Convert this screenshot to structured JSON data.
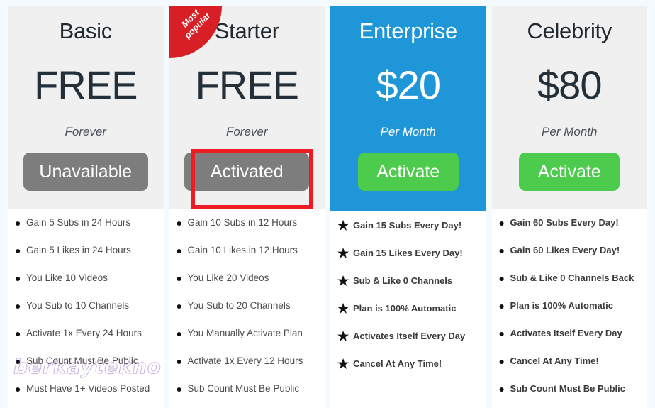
{
  "page": {
    "background_color": "#f4fafd",
    "watermark_text": "berkaytekno"
  },
  "colors": {
    "header_bg": "#f0f0f0",
    "featured_bg": "#1f96d8",
    "button_green": "#4ccb4c",
    "button_grey": "#7d7d7d",
    "badge_red": "#d91f26",
    "highlight_red": "#ed1c24"
  },
  "plans": [
    {
      "name": "Basic",
      "price": "FREE",
      "period": "Forever",
      "button_label": "Unavailable",
      "button_style": "grey",
      "badge": null,
      "highlighted": false,
      "bullet": "dot",
      "features": [
        "Gain 5 Subs in 24 Hours",
        "Gain 5 Likes in 24 Hours",
        "You Like 10 Videos",
        "You Sub to 10 Channels",
        "Activate 1x Every 24 Hours",
        "Sub Count Must Be Public",
        "Must Have 1+ Videos Posted"
      ]
    },
    {
      "name": "Starter",
      "price": "FREE",
      "period": "Forever",
      "button_label": "Activated",
      "button_style": "grey",
      "badge": "Most popular",
      "highlighted": true,
      "bullet": "dot",
      "features": [
        "Gain 10 Subs in 12 Hours",
        "Gain 10 Likes in 12 Hours",
        "You Like 20 Videos",
        "You Sub to 20 Channels",
        "You Manually Activate Plan",
        "Activate 1x Every 12 Hours",
        "Sub Count Must Be Public"
      ]
    },
    {
      "name": "Enterprise",
      "price": "$20",
      "period": "Per Month",
      "button_label": "Activate",
      "button_style": "green",
      "badge": null,
      "highlighted": false,
      "bullet": "star",
      "features": [
        "Gain 15 Subs Every Day!",
        "Gain 15 Likes Every Day!",
        "Sub & Like 0 Channels",
        "Plan is 100% Automatic",
        "Activates Itself Every Day",
        "Cancel At Any Time!"
      ]
    },
    {
      "name": "Celebrity",
      "price": "$80",
      "period": "Per Month",
      "button_label": "Activate",
      "button_style": "green",
      "badge": null,
      "highlighted": false,
      "bullet": "dot",
      "features": [
        "Gain 60 Subs Every Day!",
        "Gain 60 Likes Every Day!",
        "Sub & Like 0 Channels Back",
        "Plan is 100% Automatic",
        "Activates Itself Every Day",
        "Cancel At Any Time!",
        "Sub Count Must Be Public"
      ]
    }
  ],
  "icons": {
    "dot_bullet": "●",
    "star_bullet": "★"
  }
}
